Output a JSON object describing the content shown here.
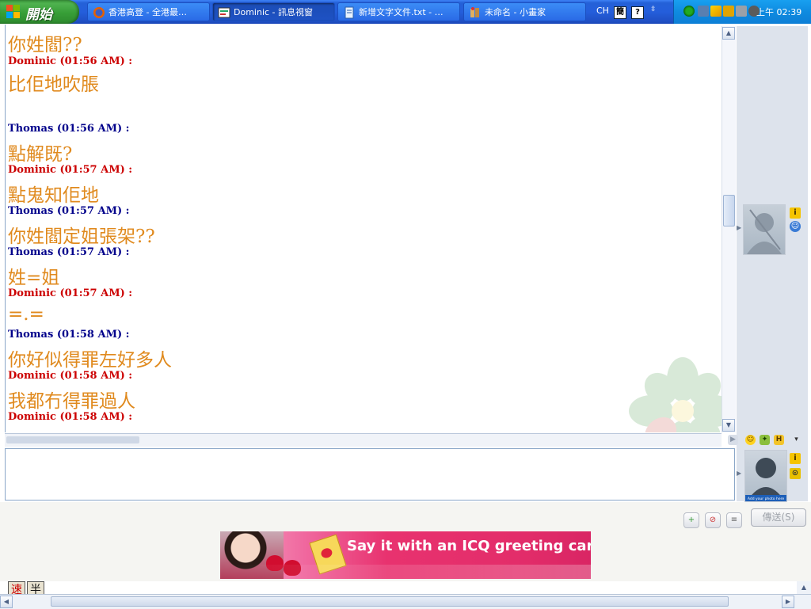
{
  "taskbar": {
    "start_label": "開始",
    "tasks": [
      {
        "label": "香港高登 - 全港最…",
        "icon": "firefox-icon"
      },
      {
        "label": "Dominic - 訊息視窗",
        "icon": "icq-message-icon",
        "active": true
      },
      {
        "label": "新增文字文件.txt - …",
        "icon": "notepad-icon"
      },
      {
        "label": "未命名 - 小畫家",
        "icon": "paint-icon"
      }
    ],
    "language": "CH",
    "clock": "上午 02:39"
  },
  "chat": {
    "messages": [
      {
        "type": "text",
        "text": "你姓閻??"
      },
      {
        "type": "sender",
        "who": "d",
        "text": "Dominic (01:56 AM) :"
      },
      {
        "type": "text",
        "text": "比佢地吹脹"
      },
      {
        "type": "sender",
        "who": "t",
        "text": "Thomas (01:56 AM) :"
      },
      {
        "type": "text",
        "text": "點解既?"
      },
      {
        "type": "sender",
        "who": "d",
        "text": "Dominic (01:57 AM) :"
      },
      {
        "type": "text",
        "text": "點鬼知佢地"
      },
      {
        "type": "sender",
        "who": "t",
        "text": "Thomas (01:57 AM) :"
      },
      {
        "type": "text",
        "text": "你姓閻定姐張架??"
      },
      {
        "type": "sender",
        "who": "t",
        "text": "Thomas (01:57 AM) :"
      },
      {
        "type": "text",
        "text": "姓=姐"
      },
      {
        "type": "sender",
        "who": "d",
        "text": "Dominic (01:57 AM) :"
      },
      {
        "type": "text",
        "text": "=.="
      },
      {
        "type": "sender",
        "who": "t",
        "text": "Thomas (01:58 AM) :"
      },
      {
        "type": "text",
        "text": "你好似得罪左好多人"
      },
      {
        "type": "sender",
        "who": "d",
        "text": "Dominic (01:58 AM) :"
      },
      {
        "type": "text",
        "text": "我都冇得罪過人"
      },
      {
        "type": "sender",
        "who": "d",
        "text": "Dominic (01:58 AM) :"
      }
    ]
  },
  "input": {
    "value": ""
  },
  "buttons": {
    "send_label": "傳送(S)"
  },
  "banner": {
    "slogan": "Say it with an ICQ greeting card!"
  },
  "avatar_caption": "Add your photo here",
  "ime": {
    "key1": "速",
    "key2": "半"
  },
  "colors": {
    "dominic": "#cc0000",
    "thomas": "#00008b",
    "message_text": "#e08a1e",
    "taskbar": "#245edb"
  }
}
